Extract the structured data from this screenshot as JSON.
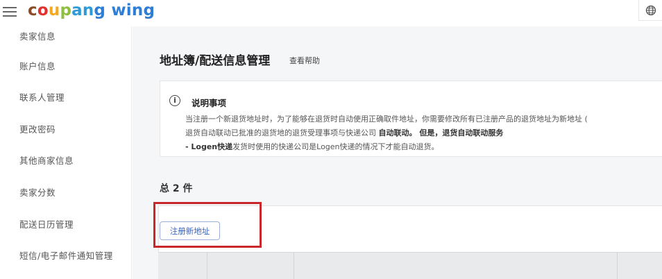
{
  "app": {
    "brand_letters": [
      {
        "ch": "c",
        "color": "#8a4b2a"
      },
      {
        "ch": "o",
        "color": "#e2302f"
      },
      {
        "ch": "u",
        "color": "#f4a91f"
      },
      {
        "ch": "p",
        "color": "#8fbf3f"
      },
      {
        "ch": "a",
        "color": "#2f9bd6"
      },
      {
        "ch": "n",
        "color": "#2f9bd6"
      },
      {
        "ch": "g",
        "color": "#2f7ed6"
      },
      {
        "ch": " ",
        "color": "#000000"
      },
      {
        "ch": "w",
        "color": "#2f7ed6"
      },
      {
        "ch": "i",
        "color": "#2f7ed6"
      },
      {
        "ch": "n",
        "color": "#2f7ed6"
      },
      {
        "ch": "g",
        "color": "#2f7ed6"
      }
    ],
    "menu_icon": "hamburger-icon",
    "language_icon": "globe-icon"
  },
  "sidebar": {
    "items": [
      {
        "label": "卖家信息"
      },
      {
        "label": "账户信息"
      },
      {
        "label": "联系人管理"
      },
      {
        "label": "更改密码"
      },
      {
        "label": "其他商家信息"
      },
      {
        "label": "卖家分数"
      },
      {
        "label": "配送日历管理"
      },
      {
        "label": "短信/电子邮件通知管理"
      }
    ]
  },
  "main": {
    "title": "地址簿/配送信息管理",
    "help_link": "查看帮助",
    "notice": {
      "title": "说明事项",
      "line1": "当注册一个新退货地址时，为了能够在退货时自动使用正确取件地址，你需要修改所有已注册产品的退货地址为新地址 (",
      "line2_normal": "退货自动联动已批准的退货地的退货受理事项与快递公司 ",
      "line2_bold": "自动联动。 但是，退货自动联动服务",
      "line3_bold": "- Logen快递",
      "line3_normal": "发货时使用的快递公司是Logen快递的情况下才能自动退货。"
    },
    "total_label": "总 2 件",
    "register_button": "注册新地址"
  },
  "colors": {
    "highlight_box": "#c9272c",
    "button_text": "#3b63b8"
  }
}
